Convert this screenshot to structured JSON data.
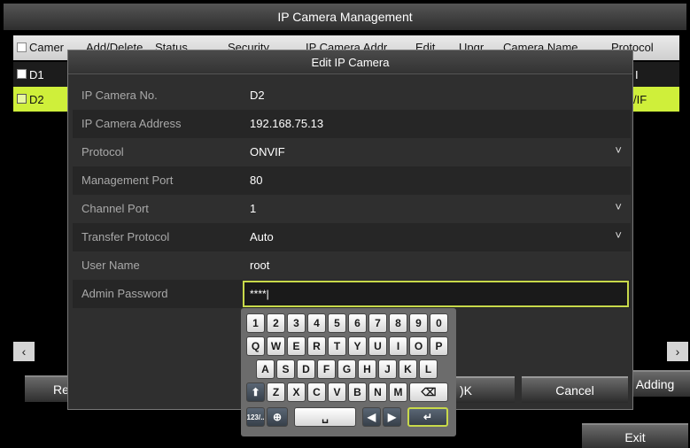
{
  "window": {
    "title": "IP Camera Management"
  },
  "table": {
    "headers": [
      "Camer",
      "Add/Delete",
      "Status",
      "Security",
      "IP Camera Addr",
      "Edit",
      "Upgr",
      "Camera Name",
      "Protocol"
    ],
    "rows": [
      {
        "camera": "D1",
        "protocol": "I"
      },
      {
        "camera": "D2",
        "protocol": "/IF"
      }
    ]
  },
  "background_buttons": {
    "refresh": "Re",
    "adding": "Adding",
    "exit": "Exit"
  },
  "dialog": {
    "title": "Edit IP Camera",
    "fields": [
      {
        "label": "IP Camera No.",
        "value": "D2"
      },
      {
        "label": "IP Camera Address",
        "value": "192.168.75.13"
      },
      {
        "label": "Protocol",
        "value": "ONVIF"
      },
      {
        "label": "Management Port",
        "value": "80"
      },
      {
        "label": "Channel Port",
        "value": "1"
      },
      {
        "label": "Transfer Protocol",
        "value": "Auto"
      },
      {
        "label": "User Name",
        "value": "root"
      },
      {
        "label": "Admin Password",
        "value": "****|"
      }
    ],
    "ok_label": "OK",
    "ok_visible": ")K",
    "cancel_label": "Cancel"
  },
  "keyboard": {
    "row_numbers": [
      "1",
      "2",
      "3",
      "4",
      "5",
      "6",
      "7",
      "8",
      "9",
      "0"
    ],
    "row_top": [
      "Q",
      "W",
      "E",
      "R",
      "T",
      "Y",
      "U",
      "I",
      "O",
      "P"
    ],
    "row_middle": [
      "A",
      "S",
      "D",
      "F",
      "G",
      "H",
      "J",
      "K",
      "L"
    ],
    "row_bottom": [
      "Z",
      "X",
      "C",
      "V",
      "B",
      "N",
      "M"
    ],
    "shift": "⬆",
    "backspace": "⌫",
    "mode": "123/..",
    "globe": "⊕",
    "space": "␣",
    "left": "◀",
    "right": "▶",
    "enter": "↵"
  },
  "scrollbar": {
    "left": "‹",
    "right": "›"
  },
  "dropdown_chevron": "˅",
  "colors": {
    "selected_row": "#cfef3a",
    "focus_border": "#c8d94a"
  }
}
